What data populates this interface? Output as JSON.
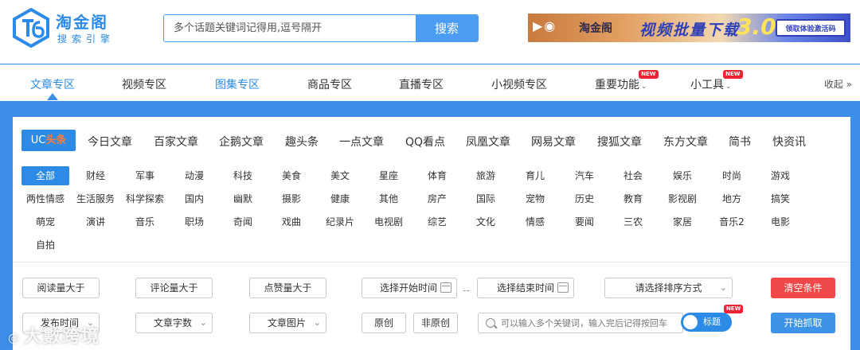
{
  "header": {
    "logo_title": "淘金阁",
    "logo_subtitle": "搜索引擎",
    "search_placeholder": "多个话题关键词记得用,逗号隔开",
    "search_button": "搜索",
    "banner": {
      "brand": "淘金阁",
      "title": "视频批量下载",
      "version": "3.0",
      "button": "领取体验激活码"
    }
  },
  "nav": {
    "items": [
      {
        "label": "文章专区"
      },
      {
        "label": "视频专区"
      },
      {
        "label": "图集专区"
      },
      {
        "label": "商品专区"
      },
      {
        "label": "直播专区"
      },
      {
        "label": "小视频专区"
      },
      {
        "label": "重要功能",
        "badge": "NEW"
      },
      {
        "label": "小工具",
        "badge": "NEW"
      }
    ],
    "collapse": "收起 »"
  },
  "sources": {
    "active_prefix": "UC",
    "active_suffix": "头条",
    "items": [
      "今日文章",
      "百家文章",
      "企鹅文章",
      "趣头条",
      "一点文章",
      "QQ看点",
      "凤凰文章",
      "网易文章",
      "搜狐文章",
      "东方文章",
      "简书",
      "快资讯"
    ]
  },
  "categories": {
    "rows": [
      [
        "全部",
        "财经",
        "军事",
        "动漫",
        "科技",
        "美食",
        "美文",
        "星座",
        "体育",
        "旅游",
        "育儿",
        "汽车",
        "社会",
        "娱乐",
        "时尚",
        "游戏"
      ],
      [
        "两性情感",
        "生活服务",
        "科学探索",
        "国内",
        "幽默",
        "摄影",
        "健康",
        "其他",
        "房产",
        "国际",
        "宠物",
        "历史",
        "教育",
        "影视剧",
        "地方",
        "搞笑"
      ],
      [
        "萌宠",
        "演讲",
        "音乐",
        "职场",
        "奇闻",
        "戏曲",
        "纪录片",
        "电视剧",
        "综艺",
        "文化",
        "情感",
        "要闻",
        "三农",
        "家居",
        "音乐2",
        "电影"
      ],
      [
        "自拍"
      ]
    ]
  },
  "filters": {
    "read_gt": "阅读量大于",
    "comment_gt": "评论量大于",
    "like_gt": "点赞量大于",
    "start_time": "选择开始时间",
    "range_sep": "--",
    "end_time": "选择结束时间",
    "sort_select": "请选择排序方式",
    "clear_button": "清空条件",
    "publish_time": "发布时间",
    "word_count": "文章字数",
    "article_images": "文章图片",
    "original": "原创",
    "non_original": "非原创",
    "keyword_placeholder": "可以输入多个关键词，输入完后记得按回车",
    "title_toggle": "标题",
    "title_toggle_badge": "NEW",
    "start_button": "开始抓取"
  },
  "watermark": "大數跨境"
}
